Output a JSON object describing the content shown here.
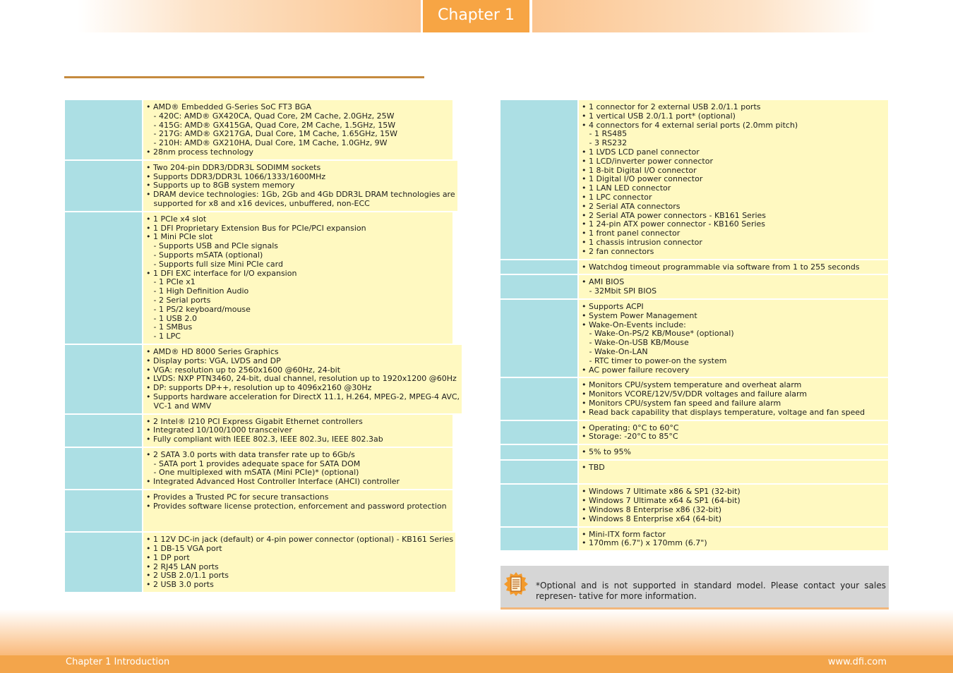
{
  "header": {
    "chapter_tab": "Chapter 1"
  },
  "left_rows": [
    {
      "lines": [
        "• AMD® Embedded G-Series SoC FT3 BGA",
        "   - 420C: AMD® GX420CA, Quad Core, 2M Cache, 2.0GHz, 25W",
        "   - 415G: AMD® GX415GA, Quad Core, 2M Cache, 1.5GHz, 15W",
        "   - 217G: AMD® GX217GA, Dual Core, 1M Cache, 1.65GHz, 15W",
        "   - 210H: AMD® GX210HA, Dual Core, 1M Cache, 1.0GHz, 9W",
        "• 28nm process technology"
      ]
    },
    {
      "lines": [
        "• Two 204-pin DDR3/DDR3L SODIMM sockets",
        "• Supports DDR3/DDR3L 1066/1333/1600MHz",
        "• Supports up to 8GB system memory",
        "• DRAM device technologies: 1Gb, 2Gb and 4Gb DDR3L DRAM technologies are",
        "   supported for x8 and x16 devices, unbuffered, non-ECC"
      ]
    },
    {
      "lines": [
        "• 1 PCIe x4 slot",
        "• 1 DFI Proprietary Extension Bus for PCIe/PCI expansion",
        "• 1 Mini PCIe slot",
        "   - Supports USB and PCIe signals",
        "   - Supports mSATA (optional)",
        "   - Supports full size Mini PCIe card",
        "• 1 DFI EXC interface for I/O expansion",
        "   - 1 PCIe x1",
        "   - 1 High Definition Audio",
        "   - 2 Serial ports",
        "   - 1 PS/2 keyboard/mouse",
        "   - 1 USB 2.0",
        "   - 1 SMBus",
        "   - 1 LPC"
      ]
    },
    {
      "lines": [
        "• AMD® HD 8000 Series Graphics",
        "• Display ports: VGA, LVDS and DP",
        "• VGA: resolution up to 2560x1600 @60Hz, 24-bit",
        "• LVDS: NXP PTN3460, 24-bit, dual channel, resolution up to 1920x1200 @60Hz",
        "• DP: supports DP++, resolution up to 4096x2160 @30Hz",
        "• Supports hardware acceleration for DirectX 11.1, H.264, MPEG-2, MPEG-4 AVC,",
        "   VC-1 and WMV"
      ]
    },
    {
      "lines": [
        "• 2 Intel® I210 PCI Express Gigabit Ethernet controllers",
        "• Integrated 10/100/1000 transceiver",
        "• Fully compliant with IEEE 802.3, IEEE 802.3u, IEEE 802.3ab"
      ]
    },
    {
      "lines": [
        "• 2 SATA 3.0 ports with data transfer rate up to 6Gb/s",
        "   - SATA port 1 provides adequate space for SATA DOM",
        "   - One multiplexed with mSATA (Mini PCIe)* (optional)",
        "• Integrated Advanced Host Controller Interface (AHCI) controller"
      ]
    },
    {
      "lines": [
        "• Provides a Trusted PC for secure transactions",
        "• Provides software license protection, enforcement and password protection",
        " ",
        " "
      ]
    },
    {
      "lines": [
        "• 1 12V DC-in jack (default) or 4-pin power connector (optional) - KB161 Series",
        "• 1 DB-15 VGA port",
        "• 1 DP port",
        "• 2 RJ45 LAN ports",
        "• 2 USB 2.0/1.1 ports",
        "• 2 USB 3.0 ports"
      ]
    }
  ],
  "right_rows": [
    {
      "lines": [
        "• 1 connector for 2 external USB 2.0/1.1 ports",
        "• 1 vertical USB 2.0/1.1 port* (optional)",
        "• 4 connectors for 4 external serial ports (2.0mm pitch)",
        "   - 1 RS485",
        "   - 3 RS232",
        "• 1 LVDS LCD panel connector",
        "• 1 LCD/inverter power connector",
        "• 1 8-bit Digital I/O connector",
        "• 1 Digital I/O power connector",
        "• 1 LAN LED connector",
        "• 1 LPC connector",
        "• 2 Serial ATA connectors",
        "• 2 Serial ATA power connectors - KB161 Series",
        "• 1 24-pin ATX power connector - KB160 Series",
        "• 1 front panel connector",
        "• 1 chassis intrusion connector",
        "• 2 fan connectors"
      ]
    },
    {
      "lines": [
        "• Watchdog timeout programmable via software from 1 to 255 seconds"
      ]
    },
    {
      "lines": [
        "• AMI BIOS",
        "   - 32Mbit SPI BIOS"
      ]
    },
    {
      "lines": [
        "• Supports ACPI",
        "• System Power Management",
        "• Wake-On-Events include:",
        "   - Wake-On-PS/2 KB/Mouse* (optional)",
        "   - Wake-On-USB KB/Mouse",
        "   - Wake-On-LAN",
        "   - RTC timer to power-on the system",
        "• AC power failure recovery"
      ]
    },
    {
      "lines": [
        "• Monitors CPU/system temperature and overheat alarm",
        "• Monitors VCORE/12V/5V/DDR voltages and failure alarm",
        "• Monitors CPU/system fan speed and failure alarm",
        "• Read back capability that displays temperature, voltage and fan speed"
      ]
    },
    {
      "lines": [
        "• Operating: 0°C to 60°C",
        "• Storage: -20°C to 85°C"
      ]
    },
    {
      "lines": [
        "• 5% to 95%"
      ]
    },
    {
      "lines": [
        "• TBD",
        " "
      ]
    },
    {
      "lines": [
        "• Windows 7 Ultimate x86 & SP1 (32-bit)",
        "• Windows 7 Ultimate x64 & SP1 (64-bit)",
        "• Windows 8 Enterprise x86 (32-bit)",
        "• Windows 8 Enterprise x64 (64-bit)"
      ]
    },
    {
      "lines": [
        "• Mini-ITX form factor",
        "• 170mm (6.7\") x 170mm (6.7\")"
      ]
    }
  ],
  "note": {
    "icon": "note-icon",
    "text": "*Optional and is not supported in standard model. Please contact your sales represen- tative for more information."
  },
  "footer": {
    "left": "Chapter 1 Introduction",
    "right": "www.dfi.com"
  }
}
